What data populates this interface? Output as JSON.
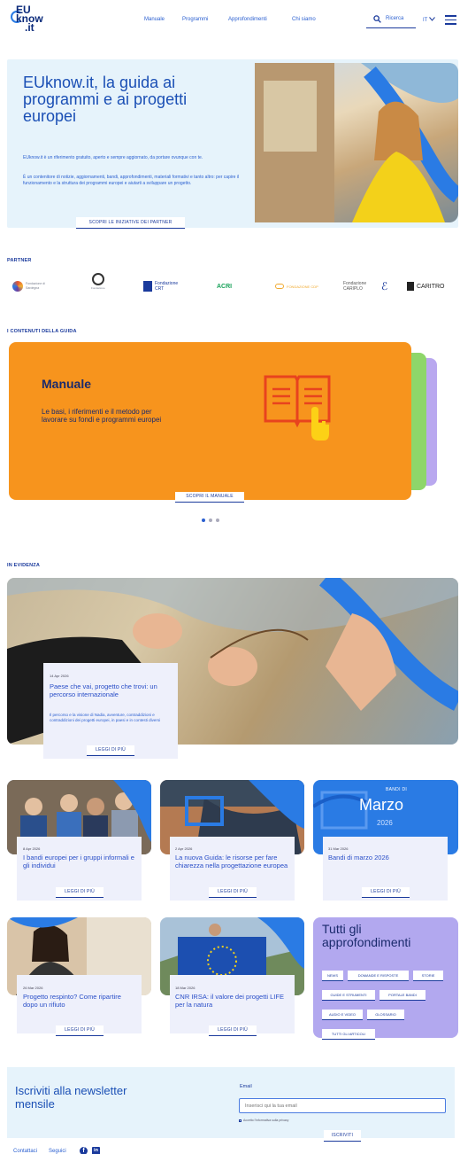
{
  "header": {
    "logo": {
      "eu": "EU",
      "know": "know",
      "it": ".it"
    },
    "nav": [
      "Manuale",
      "Programmi",
      "Approfondimenti",
      "Chi siamo"
    ],
    "search_label": "Ricerca",
    "lang": "IT"
  },
  "hero": {
    "title": "EUknow.it, la guida ai programmi e ai progetti europei",
    "p1": "EUknow.it è un riferimento gratuito, aperto e sempre aggiornato, da portare ovunque con te.",
    "p2": "È un contenitore di notizie, aggiornamenti, bandi, approfondimenti, materiali formativi e tanto altro: per capire il funzionamento e la struttura dei programmi europei e aiutarti a sviluppare un progetto.",
    "button": "SCOPRI LE INIZIATIVE DEI PARTNER"
  },
  "partners": {
    "label": "PARTNER",
    "items": [
      "Fondazione di Sardegna",
      "Fondazione",
      "Fondazione CRT",
      "ACRI",
      "FONDAZIONE CDP",
      "Fondazione CARIPLO",
      "CARITRO"
    ]
  },
  "guide": {
    "label": "I CONTENUTI DELLA GUIDA",
    "card_title": "Manuale",
    "card_text": "Le basi, i riferimenti e il metodo per lavorare su fondi e programmi europei",
    "button": "SCOPRI IL MANUALE",
    "active_slide": 1,
    "slide_count": 3
  },
  "featured": {
    "label": "IN EVIDENZA",
    "date": "14 Apr 2026",
    "title": "Paese che vai, progetto che trovi: un percorso internazionale",
    "text": "Il percorso e la visione di Nadia, avventure, contraddizioni e contraddizioni dei progetti europei, in paesi e in contesti diversi",
    "button": "LEGGI DI PIÙ"
  },
  "cards_row1": [
    {
      "date": "8 Apr 2026",
      "title": "I bandi europei per i gruppi informali e gli individui",
      "button": "LEGGI DI PIÙ"
    },
    {
      "date": "2 Apr 2026",
      "title": "La nuova Guida: le risorse per fare chiarezza nella progettazione europea",
      "button": "LEGGI DI PIÙ"
    },
    {
      "date": "31 Mar 2026",
      "title": "Bandi di marzo 2026",
      "button": "LEGGI DI PIÙ",
      "image_kicker": "BANDI DI",
      "image_month": "Marzo",
      "image_year": "2026"
    }
  ],
  "cards_row2": [
    {
      "date": "26 Mar 2026",
      "title": "Progetto respinto? Come ripartire dopo un rifiuto",
      "button": "LEGGI DI PIÙ"
    },
    {
      "date": "18 Mar 2026",
      "title": "CNR IRSA: il valore dei progetti LIFE per la natura",
      "button": "LEGGI DI PIÙ"
    }
  ],
  "all_topics": {
    "title": "Tutti gli approfondimenti",
    "tags": [
      "NEWS",
      "DOMANDE E RISPOSTE",
      "STORIE",
      "GUIDE E STRUMENTI",
      "PORTALE BANDI",
      "AUDIO E VIDEO",
      "GLOSSARIO",
      "TUTTI GLI ARTICOLI"
    ]
  },
  "newsletter": {
    "title": "Iscriviti alla newsletter mensile",
    "email_label": "Email",
    "email_placeholder": "Inserisci qui la tua email",
    "privacy": "Accetto l'informativa sulla privacy",
    "button": "ISCRIVITI"
  },
  "footer": {
    "links": [
      "Contattaci",
      "Seguici"
    ]
  }
}
